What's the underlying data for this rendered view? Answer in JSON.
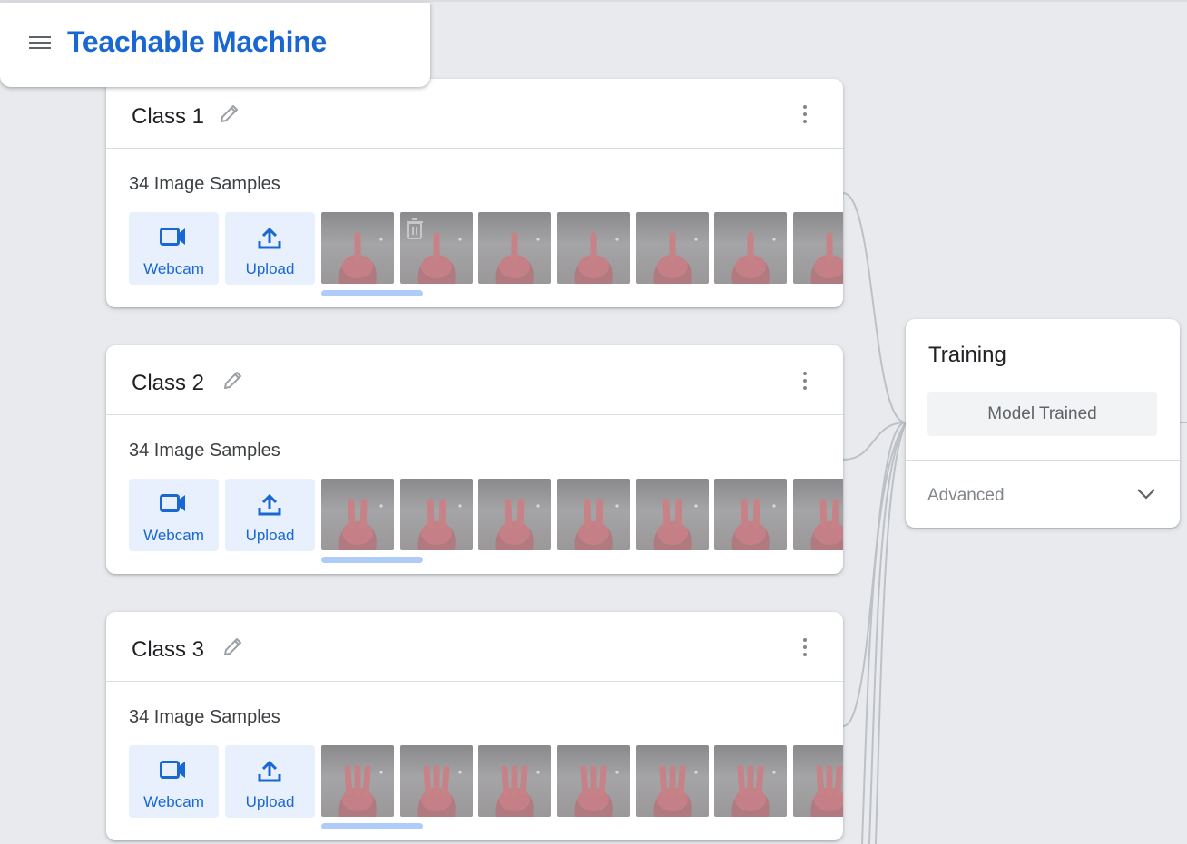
{
  "app": {
    "title": "Teachable Machine"
  },
  "classes": [
    {
      "name": "Class 1",
      "samples_label": "34 Image Samples",
      "webcam_label": "Webcam",
      "upload_label": "Upload",
      "gesture": "one finger"
    },
    {
      "name": "Class 2",
      "samples_label": "34 Image Samples",
      "webcam_label": "Webcam",
      "upload_label": "Upload",
      "gesture": "two fingers"
    },
    {
      "name": "Class 3",
      "samples_label": "34 Image Samples",
      "webcam_label": "Webcam",
      "upload_label": "Upload",
      "gesture": "three fingers"
    }
  ],
  "training": {
    "title": "Training",
    "model_button_label": "Model Trained",
    "advanced_label": "Advanced"
  },
  "colors": {
    "brand_blue": "#1967d2",
    "button_bg": "#e8f0fe",
    "progress": "#aecbfa",
    "canvas_bg": "#e8eaed"
  },
  "icons": {
    "menu": "menu-icon",
    "edit": "pencil-icon",
    "more": "more-vert-icon",
    "webcam": "videocam-icon",
    "upload": "upload-icon",
    "delete": "trash-icon",
    "expand": "chevron-down-icon"
  }
}
